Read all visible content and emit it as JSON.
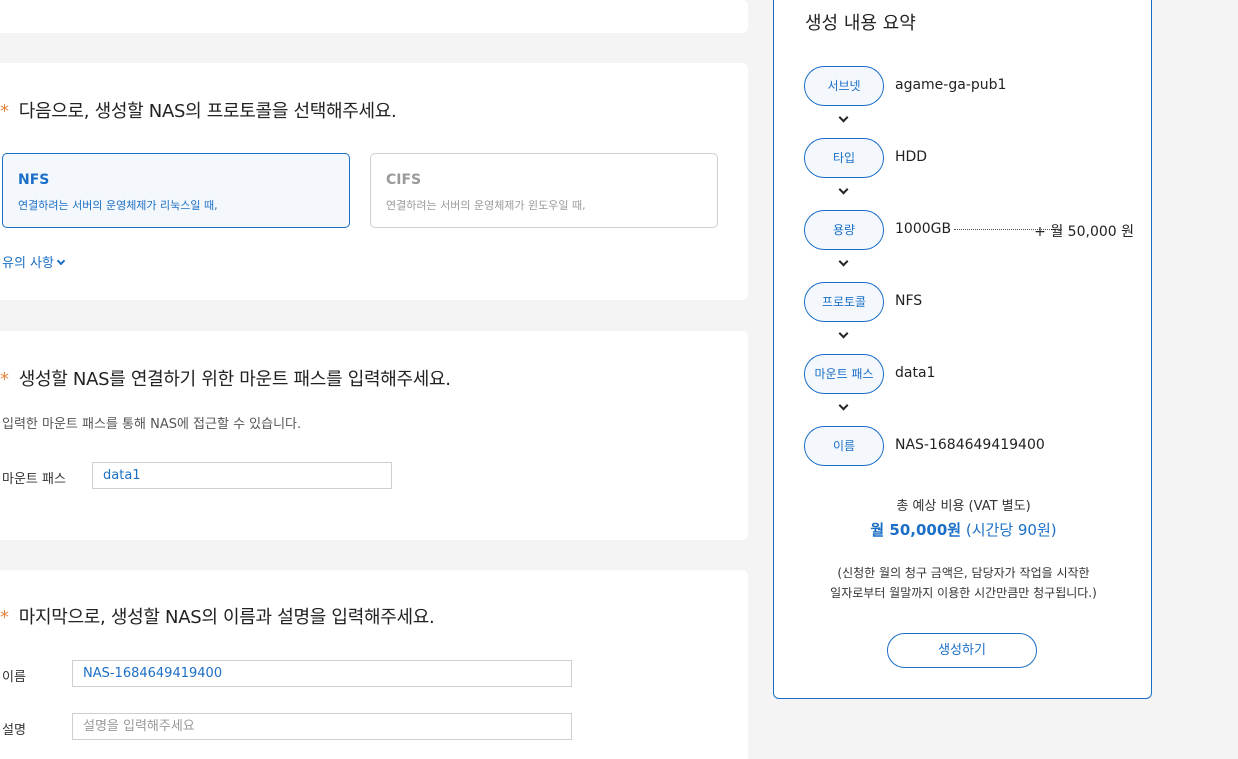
{
  "protocol_section": {
    "title": "다음으로, 생성할 NAS의 프로토콜을 선택해주세요.",
    "options": [
      {
        "name": "NFS",
        "desc": "연결하려는 서버의 운영체제가 리눅스일 때,",
        "selected": true
      },
      {
        "name": "CIFS",
        "desc": "연결하려는 서버의 운영체제가 윈도우일 때,",
        "selected": false
      }
    ],
    "notice_label": "유의 사항"
  },
  "mount_section": {
    "title": "생성할 NAS를 연결하기 위한 마운트 패스를 입력해주세요.",
    "description": "입력한 마운트 패스를 통해 NAS에 접근할 수 있습니다.",
    "field_label": "마운트 패스",
    "field_value": "data1"
  },
  "name_section": {
    "title": "마지막으로, 생성할 NAS의 이름과 설명을 입력해주세요.",
    "name_label": "이름",
    "name_value": "NAS-1684649419400",
    "desc_label": "설명",
    "desc_placeholder": "설명을 입력해주세요"
  },
  "summary": {
    "title": "생성 내용 요약",
    "rows": [
      {
        "label": "서브넷",
        "value": "agame-ga-pub1"
      },
      {
        "label": "타입",
        "value": "HDD"
      },
      {
        "label": "용량",
        "value": "1000GB",
        "price": "+ 월 50,000 원"
      },
      {
        "label": "프로토콜",
        "value": "NFS"
      },
      {
        "label": "마운트 패스",
        "value": "data1"
      },
      {
        "label": "이름",
        "value": "NAS-1684649419400"
      }
    ],
    "cost_label": "총 예상 비용 (VAT 별도)",
    "cost_main": "월 50,000원",
    "cost_hourly": " (시간당 90원)",
    "note_line1": "(신청한 월의 청구 금액은, 담당자가 작업을 시작한",
    "note_line2": "일자로부터 월말까지 이용한 시간만큼만 청구됩니다.)",
    "create_button": "생성하기"
  },
  "colors": {
    "accent": "#1c6fc6",
    "required_star": "#e8843c",
    "background": "#f4f4f4"
  }
}
